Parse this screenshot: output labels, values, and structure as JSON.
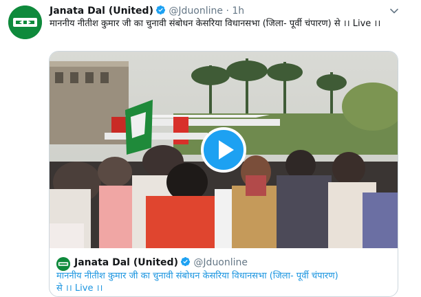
{
  "tweet": {
    "author_name": "Janata Dal (United)",
    "handle": "@Jduonline",
    "separator": "·",
    "time": "1h",
    "text": "माननीय नीतीश कुमार जी का चुनावी संबोधन केसरिया विधानसभा (जिला- पूर्वी चंपारण) से ।। Live ।।",
    "verified_icon": "verified-badge-icon",
    "menu_icon": "chevron-down-icon"
  },
  "card": {
    "media_type": "video",
    "play_icon": "play-icon",
    "quoted": {
      "author_name": "Janata Dal (United)",
      "handle": "@Jduonline",
      "text": "माननीय नीतीश कुमार जी का चुनावी संबोधन केसरिया विधानसभा (जिला- पूर्वी चंपारण) से ।। Live ।।"
    }
  },
  "colors": {
    "accent": "#1da1f2",
    "link_text": "#1b95e0",
    "secondary_text": "#657786",
    "brand_green": "#0f8a3c",
    "border": "#ccd6dd"
  }
}
